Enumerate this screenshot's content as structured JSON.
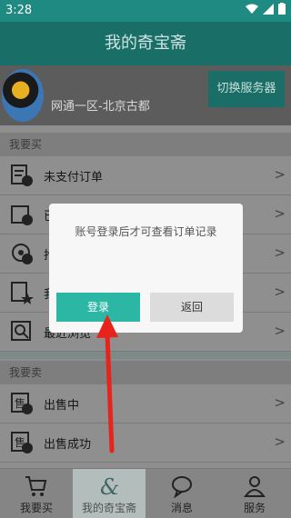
{
  "status_bar": {
    "time": "3:28"
  },
  "header": {
    "title": "我的奇宝斋"
  },
  "account": {
    "server_name": "网通一区-北京古都",
    "switch_button": "切换服务器"
  },
  "buy_section": {
    "title": "我要买",
    "items": [
      {
        "label": "未支付订单"
      },
      {
        "label": "已"
      },
      {
        "label": "抢"
      },
      {
        "label": "我"
      },
      {
        "label": "最近浏览"
      }
    ]
  },
  "sell_section": {
    "title": "我要卖",
    "items": [
      {
        "label": "出售中"
      },
      {
        "label": "出售成功"
      }
    ]
  },
  "tabbar": {
    "tabs": [
      {
        "label": "我要买",
        "icon": "cart-icon"
      },
      {
        "label": "我的奇宝斋",
        "icon": "ampersand-icon"
      },
      {
        "label": "消息",
        "icon": "chat-bubble-icon"
      },
      {
        "label": "服务",
        "icon": "person-icon"
      }
    ]
  },
  "dialog": {
    "message": "账号登录后才可查看订单记录",
    "login_button": "登录",
    "back_button": "返回"
  },
  "colors": {
    "accent": "#2bb7a4",
    "header": "#196e68",
    "annotation_arrow": "#e8231b"
  }
}
